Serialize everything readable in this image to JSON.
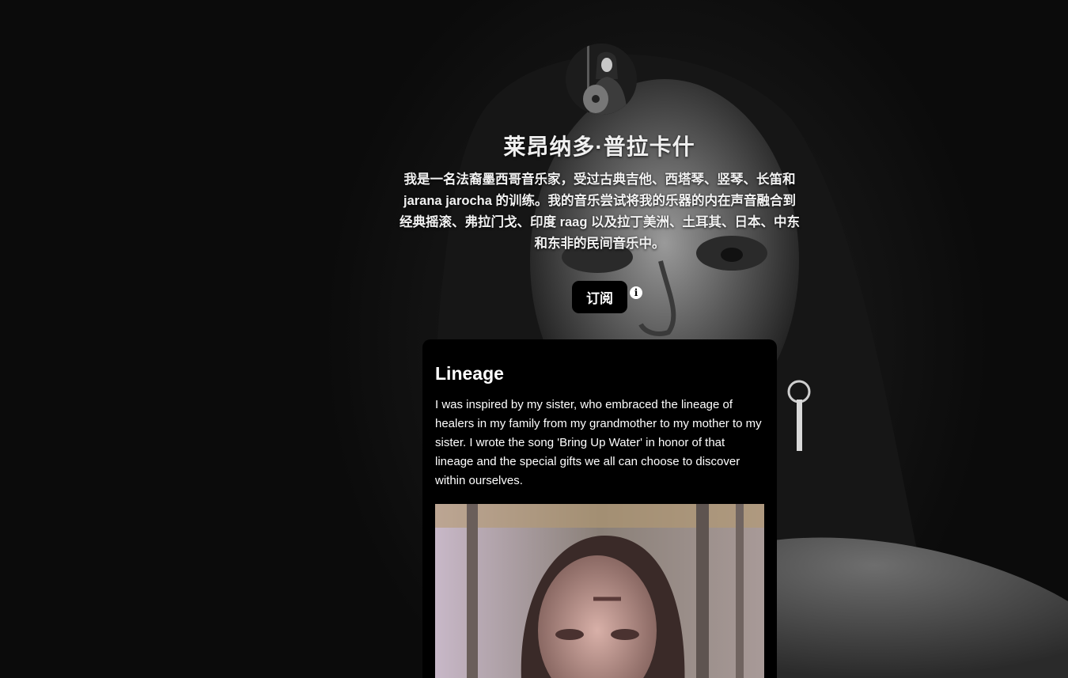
{
  "artist": {
    "name": "莱昂纳多·普拉卡什",
    "bio": "我是一名法裔墨西哥音乐家，受过古典吉他、西塔琴、竖琴、长笛和 jarana jarocha 的训练。我的音乐尝试将我的乐器的内在声音融合到经典摇滚、弗拉门戈、印度 raag 以及拉丁美洲、土耳其、日本、中东和东非的民间音乐中。"
  },
  "subscribe": {
    "label": "订阅",
    "info_icon": "info-icon"
  },
  "card": {
    "title": "Lineage",
    "text": "I was inspired by my sister, who embraced the lineage of healers in my family from my grandmother to my mother to my sister. I wrote the song 'Bring Up Water' in honor of that lineage and the special gifts we all can choose to discover within ourselves."
  },
  "colors": {
    "background": "#0b0b0b",
    "card_background": "#000000",
    "button_background": "#000000",
    "text": "#ffffff"
  }
}
